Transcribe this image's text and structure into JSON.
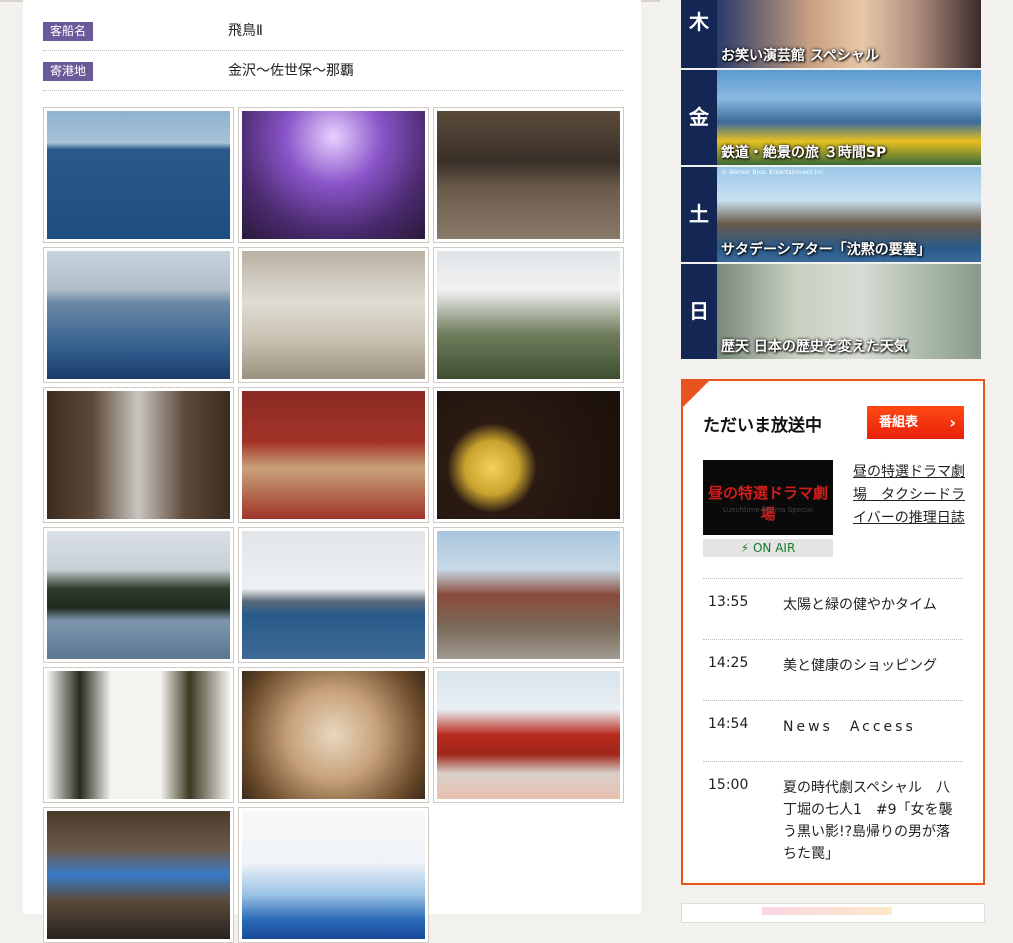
{
  "ship_info": {
    "ship_label": "客船名",
    "ship_name": "飛鳥Ⅱ",
    "port_label": "寄港地",
    "ports": "金沢～佐世保～那覇"
  },
  "photos": [
    {
      "name": "photo-cruise-ship-sea",
      "bg": "linear-gradient(#8fb3cf 0%, #a8c2d6 25%, #2a5a8a 30%, #1d4e7f 100%)"
    },
    {
      "name": "photo-ballroom-dance",
      "bg": "radial-gradient(circle at 50% 20%, #e7d1ff 0%, #8a55c9 35%, #4a2a6e 70%, #2a1a3a 100%)"
    },
    {
      "name": "photo-lecture-hall",
      "bg": "linear-gradient(#5a4a3a 0%, #3a3028 40%, #6a5a4a 60%, #8a7a6a 100%)"
    },
    {
      "name": "photo-deck-passengers",
      "bg": "linear-gradient(#c7d3de 0%, #b0bdc8 30%, #6d8aa6 40%, #2d5a8a 80%, #1a3a6a 100%)"
    },
    {
      "name": "photo-taiko-drummers",
      "bg": "linear-gradient(#b9b0a2 0%, #e0ddd4 40%, #c8c0b0 70%, #9a9080 100%)"
    },
    {
      "name": "photo-kanazawa-castle",
      "bg": "linear-gradient(#dfe4e7 0%, #f2f2f2 30%, #6f7d5c 65%, #3f4e32 100%)"
    },
    {
      "name": "photo-higashi-chaya",
      "bg": "linear-gradient(90deg, #3b2c20 0%, #5e4a3a 25%, #c9c6c1 50%, #5e4a3a 75%, #3b2c20 100%)"
    },
    {
      "name": "photo-tea-room",
      "bg": "linear-gradient(#8a2a22 0%, #a33328 40%, #c9a27a 60%, #a0352a 100%)"
    },
    {
      "name": "photo-gold-lacquer-dishes",
      "bg": "radial-gradient(circle at 30% 60%, #f3d45a 0%, #c9a22e 18%, #2a1a12 30%, #1a0f0a 100%)"
    },
    {
      "name": "photo-ship-in-bay",
      "bg": "linear-gradient(#d9dfe4 0%, #c8d0d6 30%, #2e3b2a 45%, #1e2a1e 60%, #7d96ad 70%, #5a7690 100%)"
    },
    {
      "name": "photo-gunkanjima-island",
      "bg": "linear-gradient(#e1e5e8 0%, #eef1f3 45%, #5a6a7a 55%, #2a5a8a 65%, #3d6a96 100%)"
    },
    {
      "name": "photo-ruins-tourists",
      "bg": "linear-gradient(#a9c6de 0%, #c7d9e6 30%, #8a4a3a 50%, #7a6a5a 75%, #a09a90 100%)"
    },
    {
      "name": "photo-dried-kelp",
      "bg": "linear-gradient(90deg, #f5f3ef 0%, #2a2a1e 18%, #f5f3ef 35%, #f5f3ef 62%, #3a3a22 78%, #f5f3ef 100%)"
    },
    {
      "name": "photo-kaiseki-meal",
      "bg": "radial-gradient(circle at 50% 50%, #e8d8c0 0%, #c7a27a 40%, #6a4a2a 80%, #3a2a1a 100%)"
    },
    {
      "name": "photo-shuri-castle",
      "bg": "linear-gradient(#d8e3ec 0%, #e9eff3 30%, #b82a1e 50%, #a0261a 65%, #d8d0c8 80%, #e8c0b0 100%)"
    },
    {
      "name": "photo-glass-workshop",
      "bg": "linear-gradient(#4a3a2a 0%, #6a5a4a 30%, #3a7ac8 50%, #5a4a3a 70%, #2a2220 100%)"
    },
    {
      "name": "photo-ryukyu-glass",
      "bg": "linear-gradient(#f8f8f8 0%, #f0f4f8 40%, #9cc4e4 65%, #2a6ab8 85%, #1a4a9a 100%)"
    }
  ],
  "weekly": [
    {
      "day": "木",
      "title": "お笑い演芸館 スペシャル",
      "bg": "linear-gradient(90deg, #2a3a6a 0%, #c8a080 35%, #e8c8a8 55%, #b09080 75%, #3a2a2a 100%)"
    },
    {
      "day": "金",
      "title": "鉄道・絶景の旅 ３時間SP",
      "bg": "linear-gradient(#5a9ad0 0%, #8ab8e0 30%, #3a6a9a 55%, #e8c020 75%, #3a6a3a 100%)"
    },
    {
      "day": "土",
      "title": "サタデーシアター「沈黙の要塞」",
      "bg": "linear-gradient(#9ac8e8 0%, #c8e0f0 35%, #6a5a4a 60%, #2a5a8a 85%, #3a6a9a 100%)"
    },
    {
      "day": "日",
      "title": "歴天 日本の歴史を変えた天気",
      "bg": "linear-gradient(90deg, #7a8a7a 0%, #c8d0c0 30%, #d8dcd4 55%, #a8b8a8 80%, #8a9a8a 100%)"
    }
  ],
  "weekly_copyright": "© Warner Bros. Entertainment Inc.",
  "onair": {
    "title": "ただいま放送中",
    "schedule_button": "番組表",
    "now_thumb_text": "昼の特選ドラマ劇場",
    "now_thumb_subtext": "Lunchtime Drama Special",
    "onair_label": "⚡ ON AIR",
    "now_program": "昼の特選ドラマ劇場　タクシードライバーの推理日誌",
    "schedule": [
      {
        "time": "13:55",
        "program": "太陽と緑の健やかタイム"
      },
      {
        "time": "14:25",
        "program": "美と健康のショッピング"
      },
      {
        "time": "14:54",
        "program": "News　Access"
      },
      {
        "time": "15:00",
        "program": "夏の時代劇スペシャル　八丁堀の七人1　#9「女を襲う黒い影!?島帰りの男が落ちた罠」"
      }
    ]
  }
}
